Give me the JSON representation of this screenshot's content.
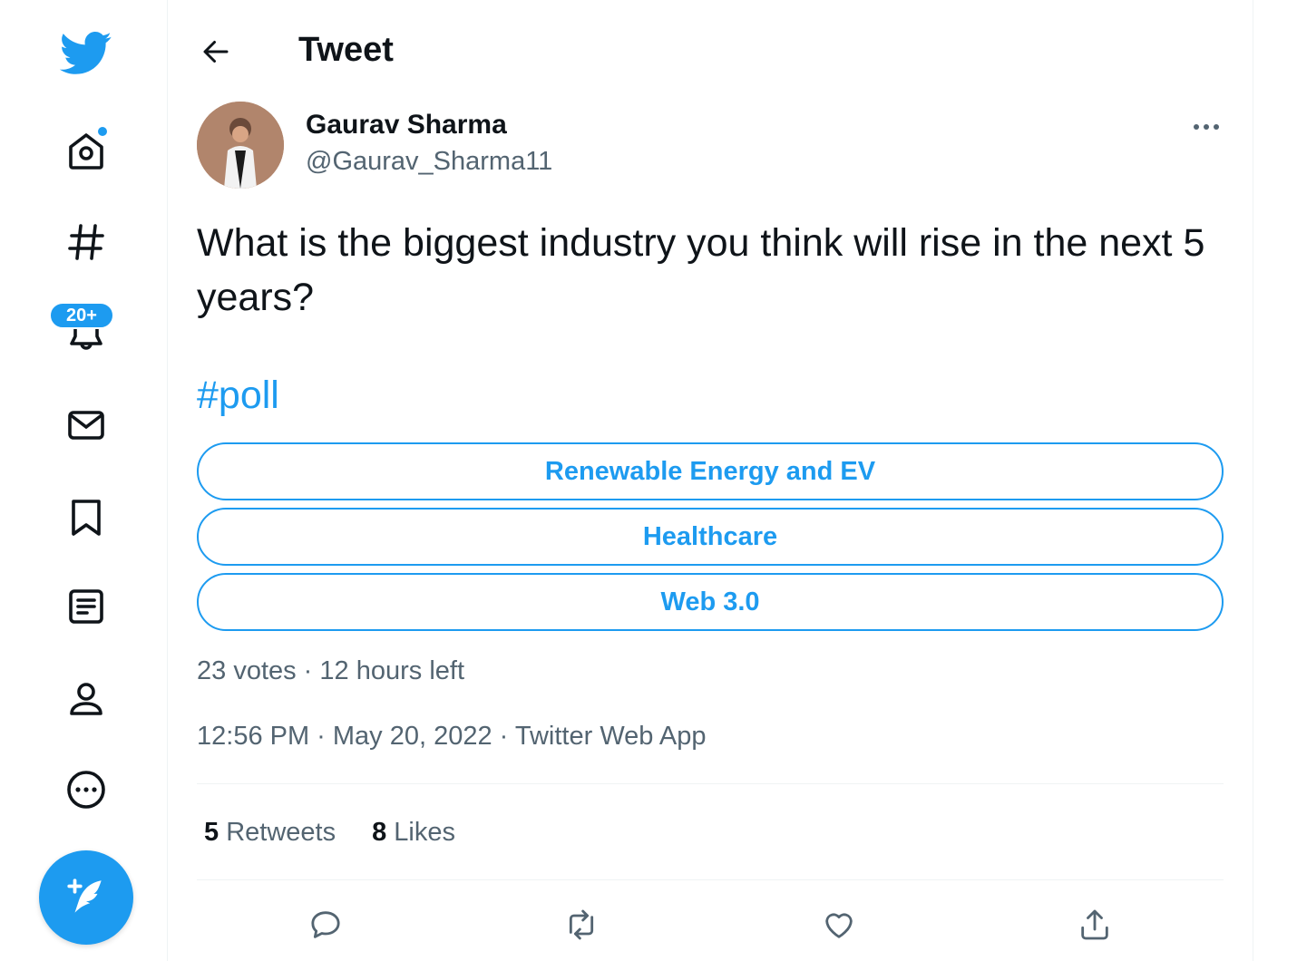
{
  "nav": {
    "items": [
      {
        "name": "home",
        "icon": "home-icon"
      },
      {
        "name": "explore",
        "icon": "hashtag-icon"
      },
      {
        "name": "notifications",
        "icon": "bell-icon"
      },
      {
        "name": "messages",
        "icon": "envelope-icon"
      },
      {
        "name": "bookmarks",
        "icon": "bookmark-icon"
      },
      {
        "name": "lists",
        "icon": "list-icon"
      },
      {
        "name": "profile",
        "icon": "person-icon"
      },
      {
        "name": "more",
        "icon": "more-circle-icon"
      }
    ],
    "notifications_badge": "20+",
    "brand_color": "#1d9bf0"
  },
  "header": {
    "title": "Tweet"
  },
  "tweet": {
    "author_name": "Gaurav Sharma",
    "author_handle": "@Gaurav_Sharma11",
    "text": "What is the biggest industry you think will rise in the next 5 years?",
    "hashtag": "#poll",
    "poll": {
      "options": [
        "Renewable Energy and EV",
        "Healthcare",
        "Web 3.0"
      ],
      "meta": "23 votes · 12 hours left"
    },
    "timestamp": "12:56 PM · May 20, 2022 · Twitter Web App",
    "stats": {
      "retweets_count": "5",
      "retweets_label": "Retweets",
      "likes_count": "8",
      "likes_label": "Likes"
    }
  }
}
